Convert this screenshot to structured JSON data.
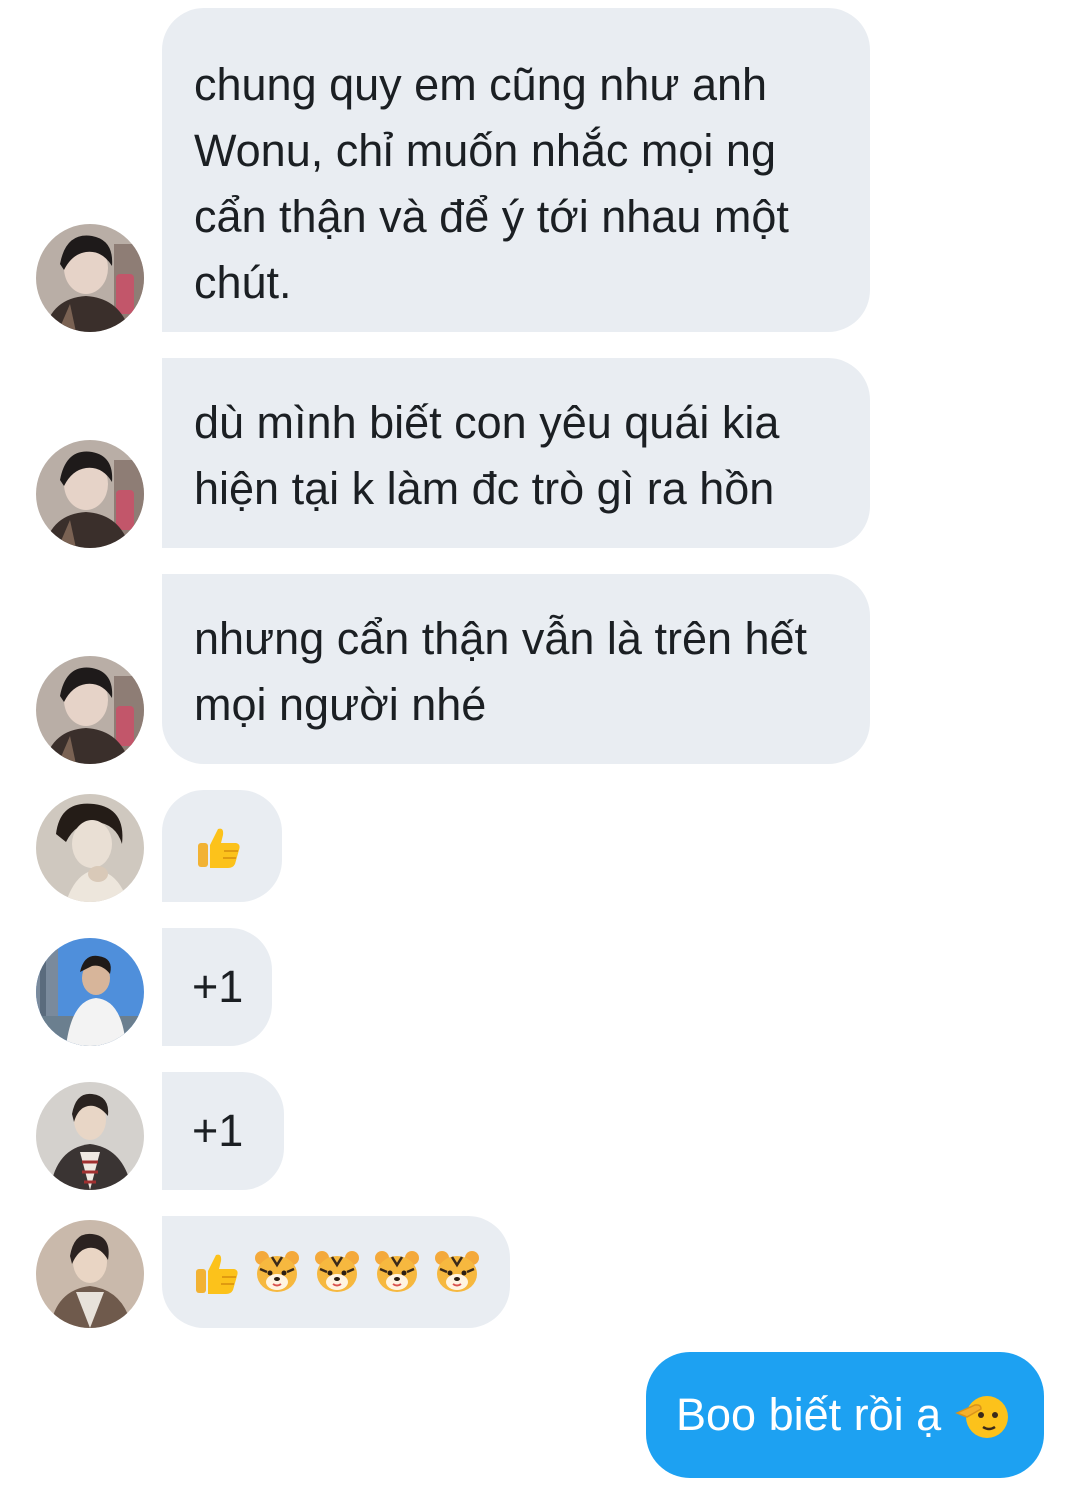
{
  "messages": [
    {
      "sender_avatar": "avatar-1",
      "lines": [
        "chung quy em cũng như anh",
        "Wonu, chỉ muốn nhắc mọi ng",
        "cẩn thận và để ý tới nhau một",
        "chút."
      ]
    },
    {
      "sender_avatar": "avatar-1",
      "lines": [
        "dù mình biết con yêu quái kia",
        "hiện tại k làm đc trò gì ra hồn"
      ]
    },
    {
      "sender_avatar": "avatar-1",
      "lines": [
        "nhưng cẩn thận vẫn là trên hết",
        "mọi người nhé"
      ]
    },
    {
      "sender_avatar": "avatar-2",
      "emojis": [
        "thumbs-up"
      ]
    },
    {
      "sender_avatar": "avatar-3",
      "text": "+1"
    },
    {
      "sender_avatar": "avatar-4",
      "text": "+1"
    },
    {
      "sender_avatar": "avatar-5",
      "emojis": [
        "thumbs-up",
        "tiger-face",
        "tiger-face",
        "tiger-face",
        "tiger-face"
      ]
    }
  ],
  "sent_message": {
    "text": "Boo biết rồi ạ",
    "emoji": "saluting-face"
  },
  "colors": {
    "received_bubble": "#e9edf2",
    "sent_bubble": "#1da1f2",
    "received_text": "#1b1f23",
    "sent_text": "#ffffff"
  }
}
